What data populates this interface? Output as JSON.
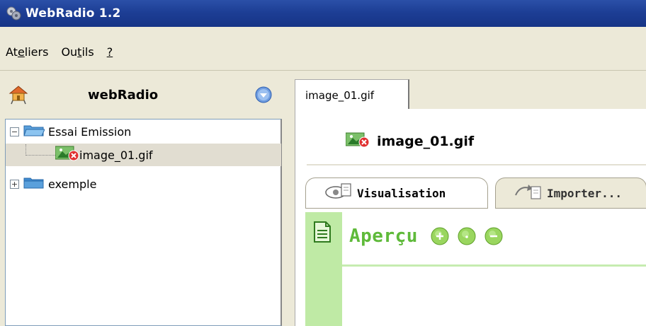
{
  "window": {
    "title": "WebRadio 1.2"
  },
  "menu": {
    "items": [
      {
        "pre": "At",
        "key": "e",
        "post": "liers"
      },
      {
        "pre": "Ou",
        "key": "t",
        "post": "ils"
      },
      {
        "pre": "",
        "key": "?",
        "post": ""
      }
    ]
  },
  "left": {
    "title": "webRadio",
    "tree": [
      {
        "label": "Essai Emission",
        "expander": "−"
      },
      {
        "label": "image_01.gif"
      },
      {
        "label": "exemple",
        "expander": "+"
      }
    ]
  },
  "right": {
    "tab_label": "image_01.gif",
    "doc_title": "image_01.gif",
    "subtabs": {
      "active": "Visualisation",
      "inactive": "Importer..."
    },
    "preview_title": "Aperçu"
  },
  "colors": {
    "accent_green": "#5fba3a",
    "titlebar_blue": "#1d3e95",
    "side_green": "#bfeaa5"
  }
}
